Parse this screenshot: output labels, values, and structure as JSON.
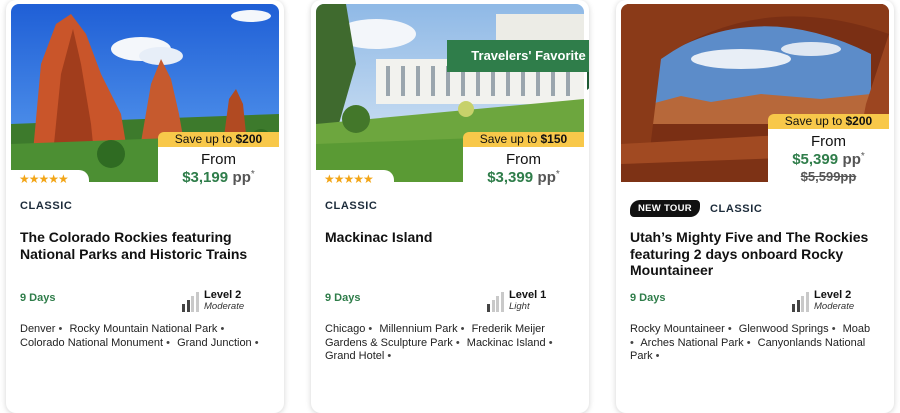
{
  "cards": [
    {
      "image": "Colorado red rock formations under blue sky",
      "save_prefix": "Save up to ",
      "save_amount": "$200",
      "from_label": "From",
      "price": "$3,199",
      "pp": "pp",
      "asterisk": "*",
      "rating_stars": "★★★★★",
      "rating": 4.5,
      "category": "CLASSIC",
      "title": "The Colorado Rockies featuring National Parks and Historic Trains",
      "days": "9 Days",
      "level_name": "Level 2",
      "level_desc": "Moderate",
      "level_value": 2,
      "places": [
        "Denver",
        "Rocky Mountain National Park",
        "Colorado National Monument",
        "Grand Junction"
      ]
    },
    {
      "image": "Grand Hotel on Mackinac Island with lawn",
      "ribbon": "Travelers' Favorite",
      "save_prefix": "Save up to ",
      "save_amount": "$150",
      "from_label": "From",
      "price": "$3,399",
      "pp": "pp",
      "asterisk": "*",
      "rating_stars": "★★★★★",
      "rating": 4.5,
      "category": "CLASSIC",
      "title": "Mackinac Island",
      "days": "9 Days",
      "level_name": "Level 1",
      "level_desc": "Light",
      "level_value": 1,
      "places": [
        "Chicago",
        "Millennium Park",
        "Frederik Meijer Gardens & Sculpture Park",
        "Mackinac Island",
        "Grand Hotel"
      ]
    },
    {
      "image": "Utah desert canyon framed by rock arch",
      "save_prefix": "Save up to ",
      "save_amount": "$200",
      "from_label": "From",
      "price": "$5,399",
      "pp": "pp",
      "asterisk": "*",
      "old_price": "$5,599pp",
      "new_tag": "NEW TOUR",
      "category": "CLASSIC",
      "title": "Utah’s Mighty Five and The Rockies featuring 2 days onboard Rocky Mountaineer",
      "days": "9 Days",
      "level_name": "Level 2",
      "level_desc": "Moderate",
      "level_value": 2,
      "places": [
        "Rocky Mountaineer",
        "Glenwood Springs",
        "Moab",
        "Arches National Park",
        "Canyonlands National Park"
      ]
    }
  ],
  "colors": {
    "accent_green": "#2f7d4a",
    "save_yellow": "#f8c84a",
    "star_gold": "#f2a517"
  }
}
